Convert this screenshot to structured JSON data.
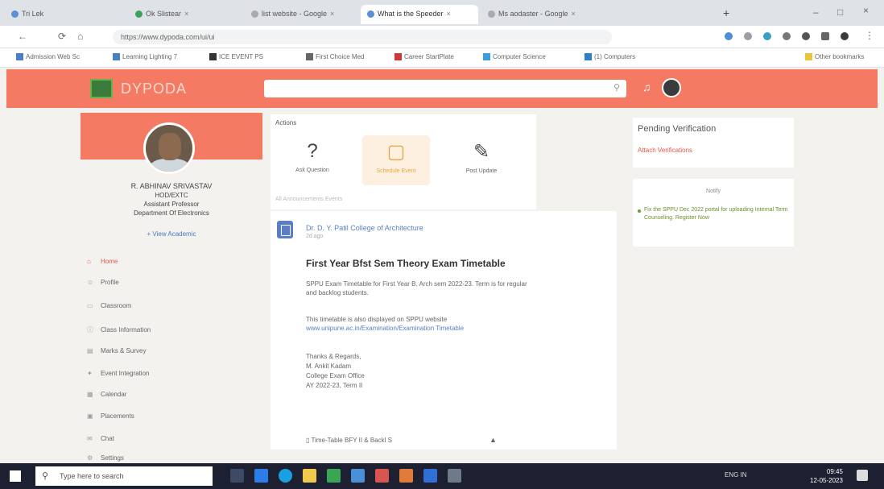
{
  "browser": {
    "tabs": [
      {
        "label": "Tri Lek"
      },
      {
        "label": "Ok Slistear"
      },
      {
        "label": "list website - Google"
      },
      {
        "label": "What is the Speeder"
      },
      {
        "label": "Ms aodaster - Google"
      }
    ],
    "url": "https://www.dypoda.com/ui/ui",
    "bookmarks": [
      {
        "label": "Admission Web Sc"
      },
      {
        "label": "Learning Lighting 7"
      },
      {
        "label": "ICE EVENT PS"
      },
      {
        "label": "First Choice Med"
      },
      {
        "label": "Career StartPlate"
      },
      {
        "label": "Computer Science"
      },
      {
        "label": "(1) Computers"
      },
      {
        "label": "Other bookmarks"
      }
    ]
  },
  "site": {
    "logo_text": "DYPODA",
    "search_icon": "search-icon",
    "bell_icon": "bell-icon"
  },
  "profile": {
    "name": "R. ABHINAV SRIVASTAV",
    "role": "HOD/EXTC",
    "designation": "Assistant Professor",
    "department": "Department Of Electronics",
    "link": "+ View Academic"
  },
  "menu": [
    {
      "label": "Home",
      "icon": "home-icon",
      "active": true
    },
    {
      "label": "Profile",
      "icon": "user-icon",
      "active": false
    },
    {
      "label": "Classroom",
      "icon": "classroom-icon",
      "active": false
    },
    {
      "label": "Class Information",
      "icon": "info-icon",
      "active": false
    },
    {
      "label": "Marks & Survey",
      "icon": "chart-icon",
      "active": false
    },
    {
      "label": "Event Integration",
      "icon": "event-icon",
      "active": false
    },
    {
      "label": "Calendar",
      "icon": "calendar-icon",
      "active": false
    },
    {
      "label": "Placements",
      "icon": "briefcase-icon",
      "active": false
    },
    {
      "label": "Chat",
      "icon": "chat-icon",
      "active": false
    },
    {
      "label": "Settings",
      "icon": "gear-icon",
      "active": false
    }
  ],
  "actions": {
    "label": "Actions",
    "items": [
      {
        "label": "Ask Question",
        "icon": "question-icon"
      },
      {
        "label": "Schedule Event",
        "icon": "calendar-icon"
      },
      {
        "label": "Post Update",
        "icon": "pencil-icon"
      }
    ],
    "tabs_text": "All    Announcements    Events"
  },
  "post": {
    "author": "Dr. D. Y. Patil College of Architecture",
    "time": "2d ago",
    "title": "First Year Bfst Sem Theory Exam Timetable",
    "body1": "SPPU Exam Timetable for First Year B. Arch sem 2022-23. Term is for regular",
    "body2": "and backlog students.",
    "body3": "This timetable is also displayed on SPPU website",
    "link": "www.unipune.ac.in/Examination/Examination Timetable",
    "sign1": "Thanks & Regards,",
    "sign2": "M. Ankit Kadam",
    "sign3": "College Exam Office",
    "sign4": "AY 2022-23, Term II",
    "attachment": "Time-Table BFY II & Backl S"
  },
  "right": {
    "verify_title": "Pending Verification",
    "verify_link": "Attach Verifications",
    "notice_head": "Notify",
    "notice_text": "Fix the SPPU Dec 2022 portal for uploading Internal Term Counseling. Register Now"
  },
  "taskbar": {
    "search_placeholder": "Type here to search",
    "tray": "ENG  IN",
    "time": "09:45",
    "date": "12-05-2023"
  },
  "colors": {
    "brand": "#f47a64",
    "link": "#5a7ec5",
    "accent": "#e2584a"
  }
}
